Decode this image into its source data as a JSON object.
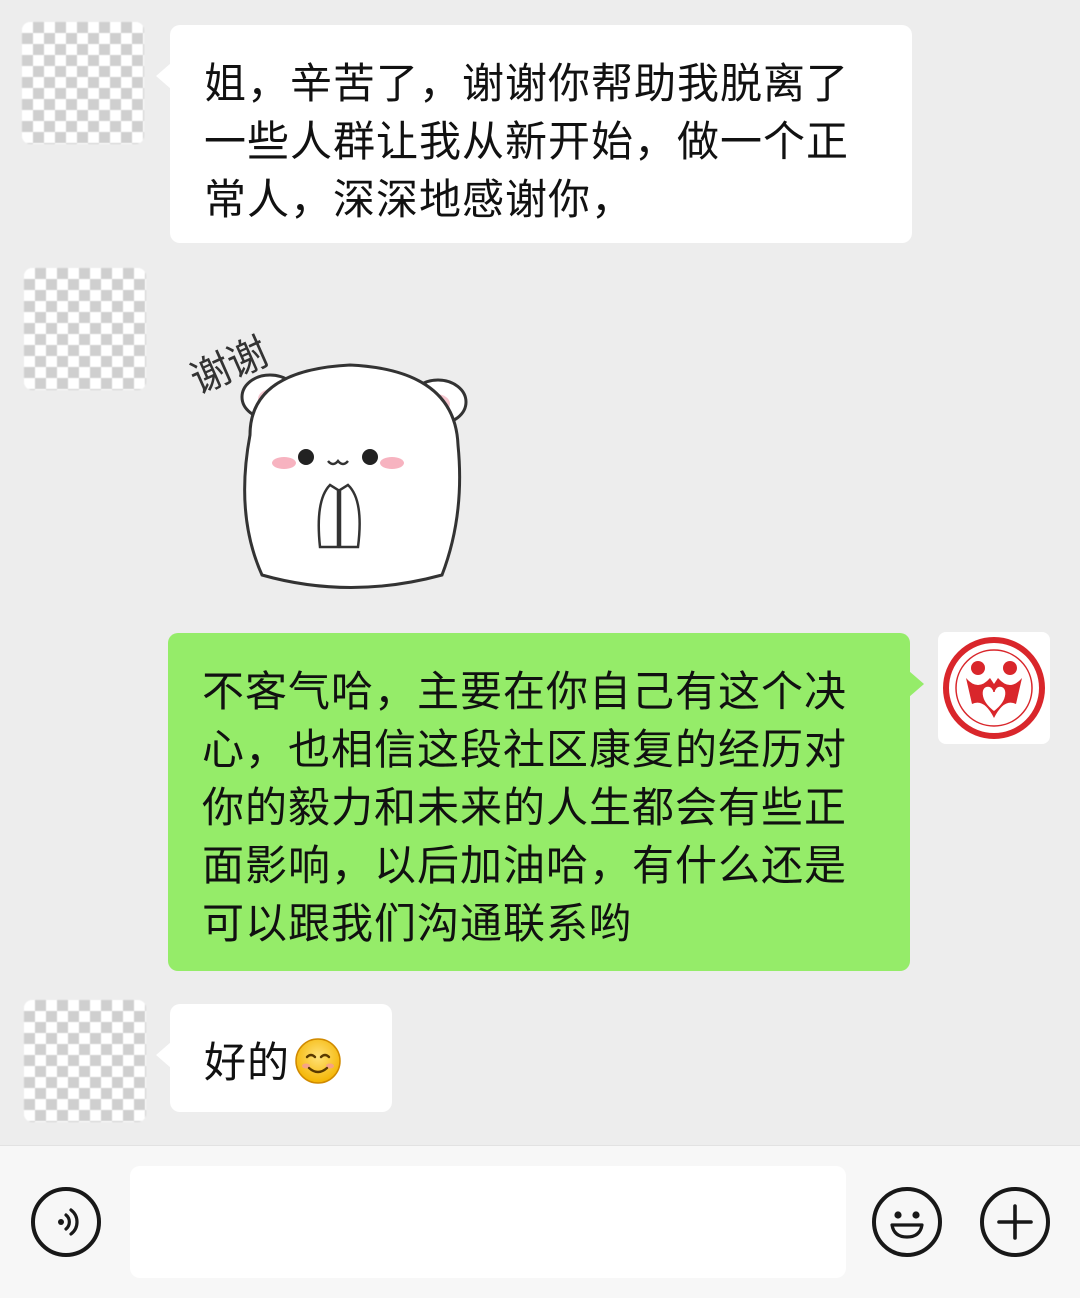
{
  "messages": [
    {
      "sender": "other",
      "type": "text",
      "lines": [
        "姐，辛苦了，谢谢你帮助我脱离了",
        "一些人群让我从新开始，做一个正",
        "常人，深深地感谢你，"
      ]
    },
    {
      "sender": "other",
      "type": "sticker",
      "sticker_text": "谢谢",
      "sticker_icon": "hamster-praying-sticker"
    },
    {
      "sender": "self",
      "type": "text",
      "lines": [
        "不客气哈，主要在你自己有这个决",
        "心，也相信这段社区康复的经历对",
        "你的毅力和未来的人生都会有些正",
        "面影响，以后加油哈，有什么还是",
        "可以跟我们沟通联系哟"
      ]
    },
    {
      "sender": "other",
      "type": "text",
      "lines": [
        "好的"
      ],
      "emoji": "smiling-face-emoji"
    }
  ],
  "input_bar": {
    "voice_icon": "voice-icon",
    "emoji_icon": "emoji-icon",
    "plus_icon": "plus-icon",
    "message_value": ""
  },
  "colors": {
    "background": "#ededed",
    "incoming_bubble": "#ffffff",
    "outgoing_bubble": "#95ec69",
    "logo_red": "#d9262b"
  }
}
